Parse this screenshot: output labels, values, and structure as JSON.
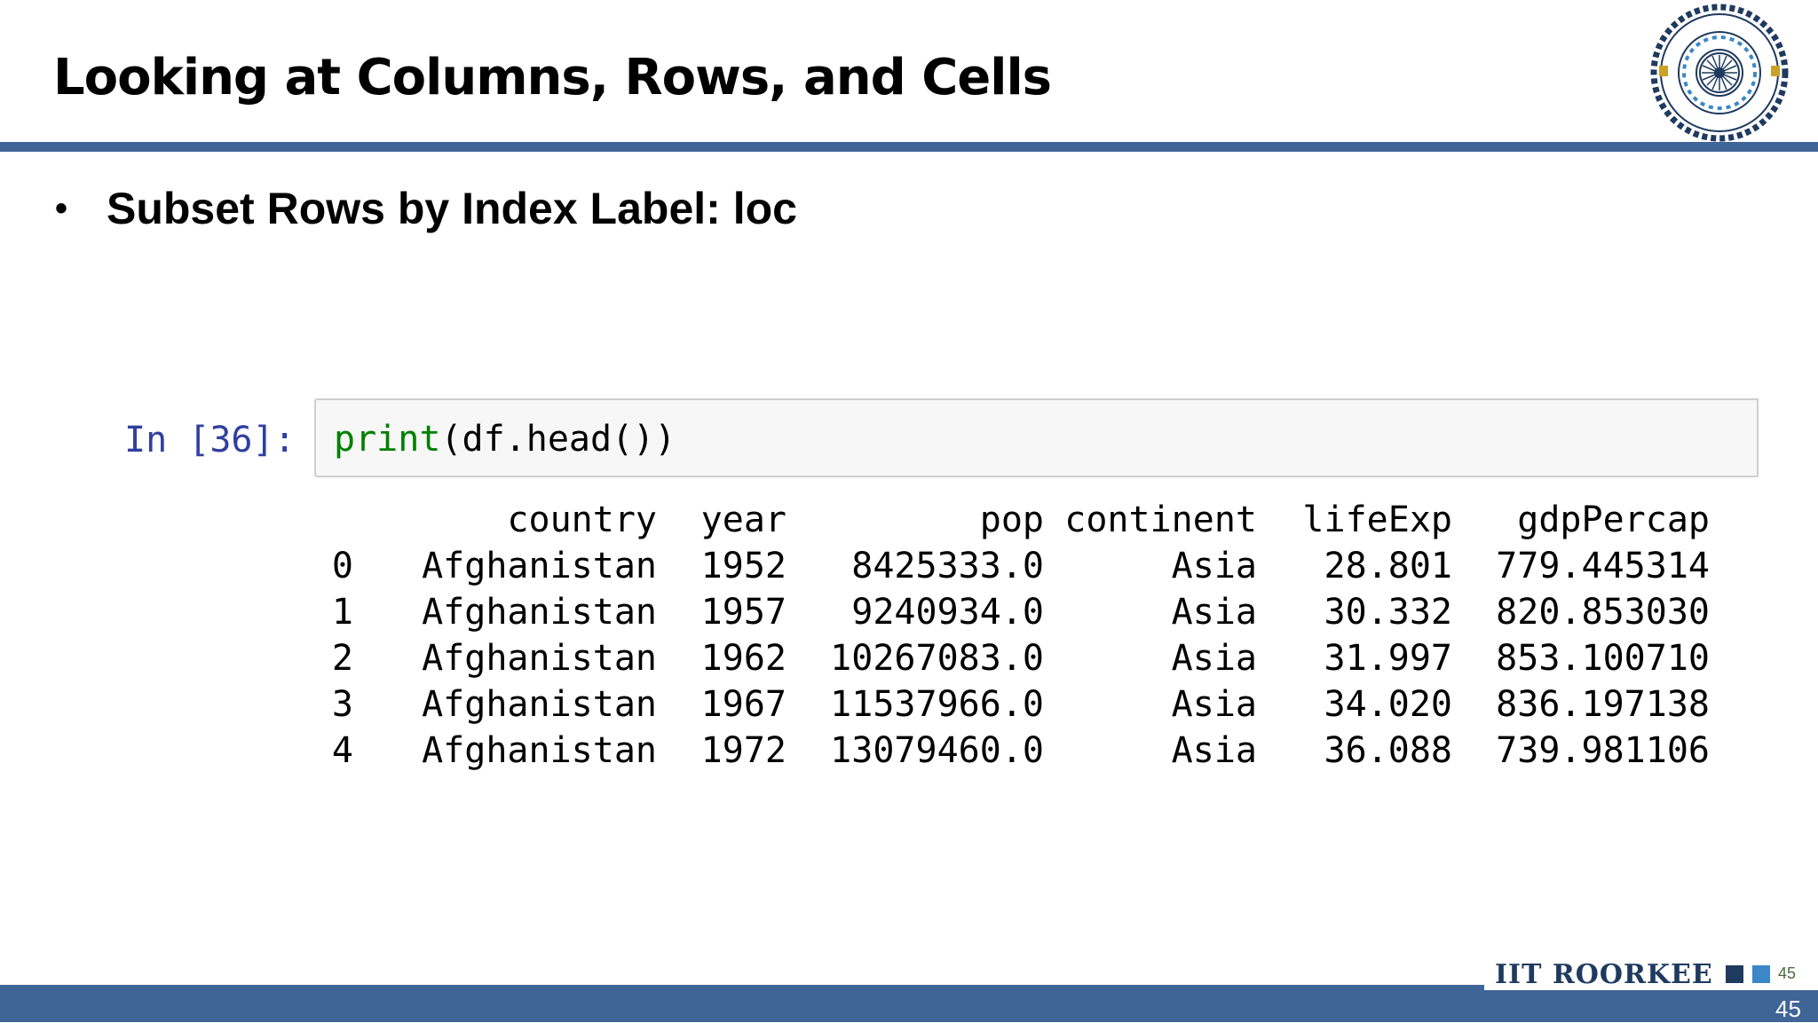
{
  "slide": {
    "title": "Looking at Columns, Rows, and Cells",
    "bullet": "Subset Rows by Index Label: loc"
  },
  "logo": {
    "institute_name": "INDIAN INSTITUTE OF TECHNOLOGY ROORKEE",
    "icon": "institute-seal"
  },
  "notebook": {
    "prompt": "In [36]:",
    "code_func": "print",
    "code_rest": "(df.head())",
    "output": {
      "columns": [
        "",
        "country",
        "year",
        "pop",
        "continent",
        "lifeExp",
        "gdpPercap"
      ],
      "rows": [
        [
          "0",
          "Afghanistan",
          "1952",
          "8425333.0",
          "Asia",
          "28.801",
          "779.445314"
        ],
        [
          "1",
          "Afghanistan",
          "1957",
          "9240934.0",
          "Asia",
          "30.332",
          "820.853030"
        ],
        [
          "2",
          "Afghanistan",
          "1962",
          "10267083.0",
          "Asia",
          "31.997",
          "853.100710"
        ],
        [
          "3",
          "Afghanistan",
          "1967",
          "11537966.0",
          "Asia",
          "34.020",
          "836.197138"
        ],
        [
          "4",
          "Afghanistan",
          "1972",
          "13079460.0",
          "Asia",
          "36.088",
          "739.981106"
        ]
      ]
    }
  },
  "footer": {
    "brand": "IIT ROORKEE",
    "mini_number": "45",
    "page_number": "45"
  },
  "colors": {
    "accent_bar": "#3f6597",
    "prompt": "#303f9f",
    "builtin": "#008000",
    "brand": "#1f3a5f"
  }
}
